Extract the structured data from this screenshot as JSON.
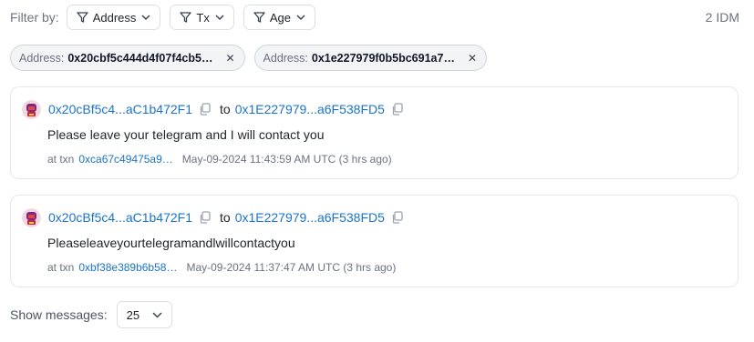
{
  "filter": {
    "label": "Filter by:",
    "buttons": [
      "Address",
      "Tx",
      "Age"
    ],
    "count": "2 IDM"
  },
  "chips": [
    {
      "key": "Address:",
      "value": "0x20cbf5c444d4f07f4cb5…",
      "close": "✕"
    },
    {
      "key": "Address:",
      "value": "0x1e227979f0b5bc691a7…",
      "close": "✕"
    }
  ],
  "messages": [
    {
      "from": "0x20cBf5c4...aC1b472F1",
      "to_word": "to",
      "to": "0x1E227979...a6F538FD5",
      "text": "Please leave your telegram and I will contact you",
      "at": "at txn",
      "txn": "0xca67c49475a9…",
      "time": "May-09-2024 11:43:59 AM UTC (3 hrs ago)"
    },
    {
      "from": "0x20cBf5c4...aC1b472F1",
      "to_word": "to",
      "to": "0x1E227979...a6F538FD5",
      "text": "Pleaseleaveyourtelegramandlwillcontactyou",
      "at": "at txn",
      "txn": "0xbf38e389b6b58…",
      "time": "May-09-2024 11:37:47 AM UTC (3 hrs ago)"
    }
  ],
  "footer": {
    "label": "Show messages:",
    "value": "25"
  },
  "colors": {
    "link": "#1a73c9",
    "muted": "#6b7280",
    "border": "#e5e7eb",
    "chip_bg": "#f3f4f6"
  },
  "icons": [
    "filter-icon",
    "chevron-down-icon",
    "close-icon",
    "copy-icon",
    "avatar-icon"
  ]
}
